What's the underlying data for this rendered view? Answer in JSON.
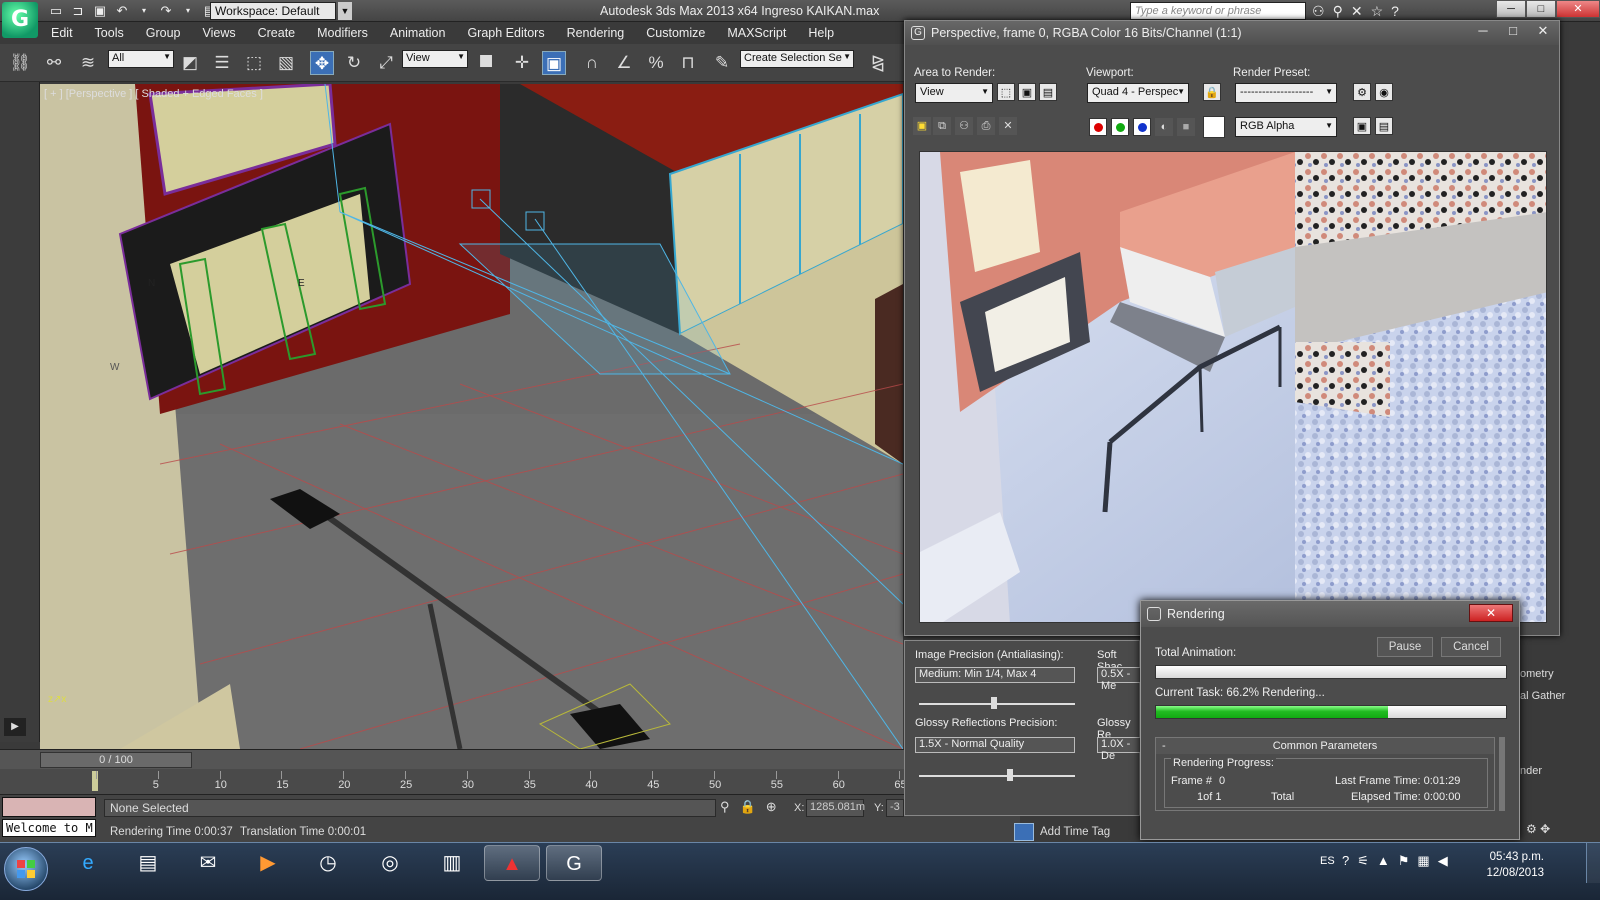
{
  "titlebar": {
    "workspace": "Workspace: Default",
    "app_title": "Autodesk 3ds Max  2013 x64     Ingreso KAIKAN.max",
    "search_placeholder": "Type a keyword or phrase"
  },
  "menu": [
    "Edit",
    "Tools",
    "Group",
    "Views",
    "Create",
    "Modifiers",
    "Animation",
    "Graph Editors",
    "Rendering",
    "Customize",
    "MAXScript",
    "Help"
  ],
  "toolbar": {
    "filter_select": "All",
    "ref_coord_select": "View",
    "selection_set": "Create Selection Se"
  },
  "viewport": {
    "label": "[ + ] [Perspective ] [ Shaded + Edged Faces ]",
    "compass": [
      "N",
      "E",
      "W"
    ]
  },
  "timeline": {
    "frame_display": "0 / 100",
    "ticks": [
      "0",
      "5",
      "10",
      "15",
      "20",
      "25",
      "30",
      "35",
      "40",
      "45",
      "50",
      "55",
      "60",
      "65"
    ]
  },
  "status": {
    "selection": "None Selected",
    "welcome": "Welcome to M",
    "x_label": "X:",
    "x_value": "1285.081m",
    "y_label": "Y:",
    "y_value": "-3",
    "rendering_time": "Rendering Time  0:00:37",
    "translation_time": "Translation Time  0:00:01",
    "add_time_tag": "Add Time Tag"
  },
  "render_window": {
    "title": "Perspective, frame 0, RGBA Color 16 Bits/Channel (1:1)",
    "area_label": "Area to Render:",
    "area_value": "View",
    "viewport_label": "Viewport:",
    "viewport_value": "Quad 4 - Perspec",
    "preset_label": "Render Preset:",
    "preset_value": "--------------------",
    "channel_value": "RGB Alpha"
  },
  "lower_panel": {
    "image_precision_label": "Image Precision (Antialiasing):",
    "image_precision_value": "Medium: Min 1/4, Max 4",
    "soft_shadows_label": "Soft Shac",
    "soft_shadows_value": "0.5X - Me",
    "glossy_refl_label": "Glossy Reflections Precision:",
    "glossy_refl_value": "1.5X - Normal Quality",
    "glossy_refr_label": "Glossy Re",
    "glossy_refr_value": "1.0X - De",
    "right_geometry": "ometry",
    "right_final_gather": "al Gather",
    "right_render": "nder"
  },
  "rendering_dialog": {
    "title": "Rendering",
    "pause": "Pause",
    "cancel": "Cancel",
    "total_animation_label": "Total Animation:",
    "total_animation_progress": 0.0,
    "current_task_label": "Current Task:   66.2%  Rendering...",
    "current_task_progress": 0.662,
    "group_title": "Common Parameters",
    "group_minus": "-",
    "progress_title": "Rendering Progress:",
    "frame_label": "Frame #",
    "frame_value": "0",
    "frame_of": "1of 1",
    "total_label": "Total",
    "last_frame_label": "Last Frame Time:  0:01:29",
    "elapsed_label": "Elapsed Time:  0:00:00"
  },
  "taskbar": {
    "lang": "ES",
    "time": "05:43 p.m.",
    "date": "12/08/2013",
    "apps": [
      "ie-icon",
      "explorer-icon",
      "outlook-icon",
      "media-player-icon",
      "clock-app-icon",
      "chrome-icon",
      "task-manager-icon",
      "autocad-icon",
      "3dsmax-icon"
    ]
  },
  "colors": {
    "accent": "#3b6fb6",
    "progress_green": "#22bb22",
    "viewport_bg": "#6b6b6b"
  }
}
